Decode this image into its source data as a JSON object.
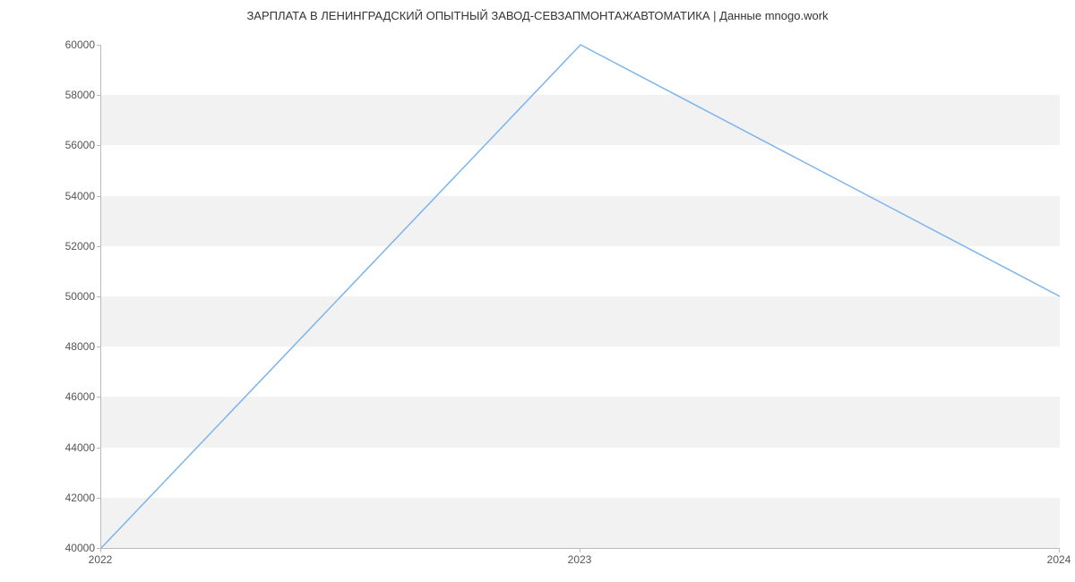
{
  "chart_data": {
    "type": "line",
    "title": "ЗАРПЛАТА В  ЛЕНИНГРАДСКИЙ ОПЫТНЫЙ ЗАВОД-СЕВЗАПМОНТАЖАВТОМАТИКА | Данные mnogo.work",
    "x": [
      2022,
      2023,
      2024
    ],
    "values": [
      40000,
      60000,
      50000
    ],
    "xlabel": "",
    "ylabel": "",
    "xlim": [
      2022,
      2024
    ],
    "ylim": [
      40000,
      60000
    ],
    "x_ticks": [
      2022,
      2023,
      2024
    ],
    "y_ticks": [
      40000,
      42000,
      44000,
      46000,
      48000,
      50000,
      52000,
      54000,
      56000,
      58000,
      60000
    ],
    "line_color": "#7cb5ec"
  }
}
